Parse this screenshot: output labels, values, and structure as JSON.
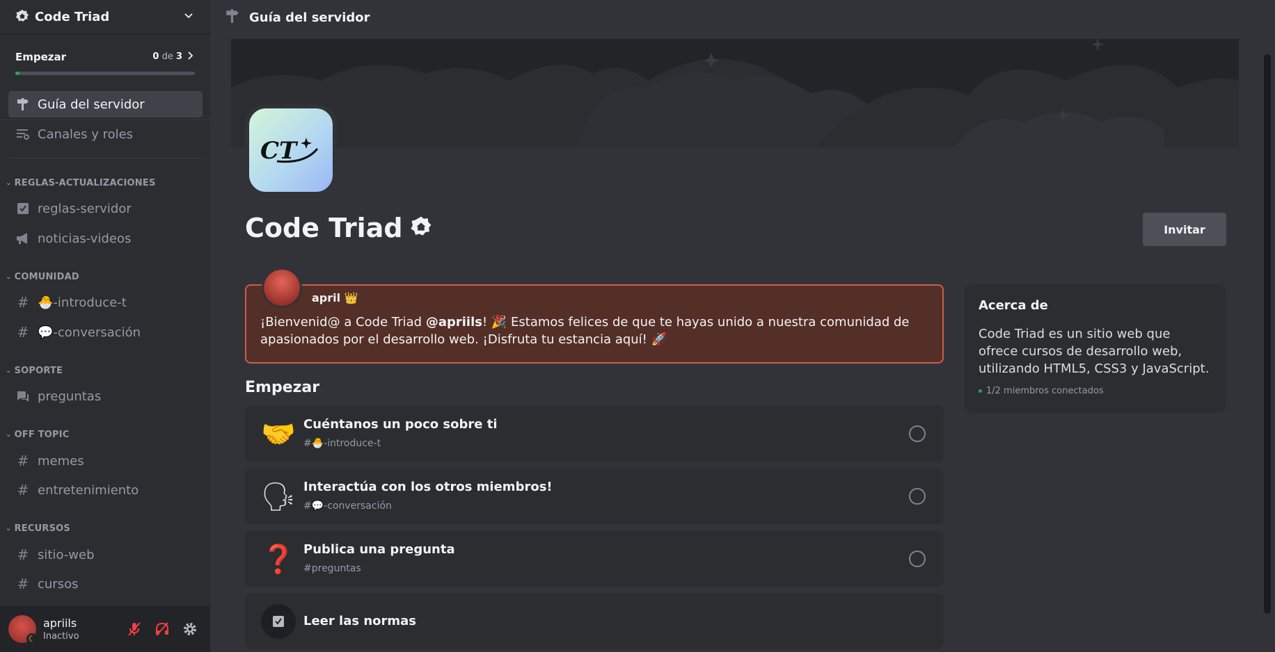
{
  "server": {
    "name": "Code Triad",
    "icon_text": "CT"
  },
  "progress": {
    "title": "Empezar",
    "done": "0",
    "of": "de",
    "total": "3",
    "fraction": 0.02
  },
  "sidebar": {
    "top_items": [
      {
        "label": "Guía del servidor",
        "icon": "signpost-icon",
        "active": true
      },
      {
        "label": "Canales y roles",
        "icon": "channels-list-icon",
        "active": false
      }
    ],
    "categories": [
      {
        "name": "REGLAS-ACTUALIZACIONES",
        "channels": [
          {
            "label": "reglas-servidor",
            "icon": "rules-icon"
          },
          {
            "label": "noticias-videos",
            "icon": "megaphone-icon"
          }
        ]
      },
      {
        "name": "COMUNIDAD",
        "channels": [
          {
            "label": "🐣-introduce-t",
            "icon": "hash-icon"
          },
          {
            "label": "💬-conversación",
            "icon": "hash-icon"
          }
        ]
      },
      {
        "name": "SOPORTE",
        "channels": [
          {
            "label": "preguntas",
            "icon": "forum-icon"
          }
        ]
      },
      {
        "name": "OFF TOPIC",
        "channels": [
          {
            "label": "memes",
            "icon": "hash-icon"
          },
          {
            "label": "entretenimiento",
            "icon": "hash-icon"
          }
        ]
      },
      {
        "name": "RECURSOS",
        "channels": [
          {
            "label": "sitio-web",
            "icon": "hash-icon"
          },
          {
            "label": "cursos",
            "icon": "hash-icon"
          }
        ]
      }
    ]
  },
  "user": {
    "name": "apriils",
    "status": "Inactivo"
  },
  "topbar": {
    "title": "Guía del servidor"
  },
  "main": {
    "invite_label": "Invitar",
    "welcome": {
      "author": "april",
      "author_badge": "👑",
      "msg_part1": "¡Bienvenid@ a Code Triad ",
      "mention": "@apriils",
      "msg_part2": "! 🎉 Estamos felices de que te hayas unido a nuestra comunidad de apasionados por el desarrollo web. ¡Disfruta tu estancia aquí! 🚀"
    },
    "start_heading": "Empezar",
    "tasks": [
      {
        "title": "Cuéntanos un poco sobre ti",
        "sub": "#🐣-introduce-t",
        "emoji": "🤝"
      },
      {
        "title": "Interactúa con los otros miembros!",
        "sub": "#💬-conversación",
        "emoji": "🗣"
      },
      {
        "title": "Publica una pregunta",
        "sub": "#preguntas",
        "emoji": "❓"
      },
      {
        "title": "Leer las normas",
        "sub": "",
        "emoji": ""
      }
    ]
  },
  "about": {
    "heading": "Acerca de",
    "text": "Code Triad es un sitio web que ofrece cursos de desarrollo web, utilizando HTML5, CSS3 y JavaScript.",
    "online": "1/2 miembros conectados"
  }
}
